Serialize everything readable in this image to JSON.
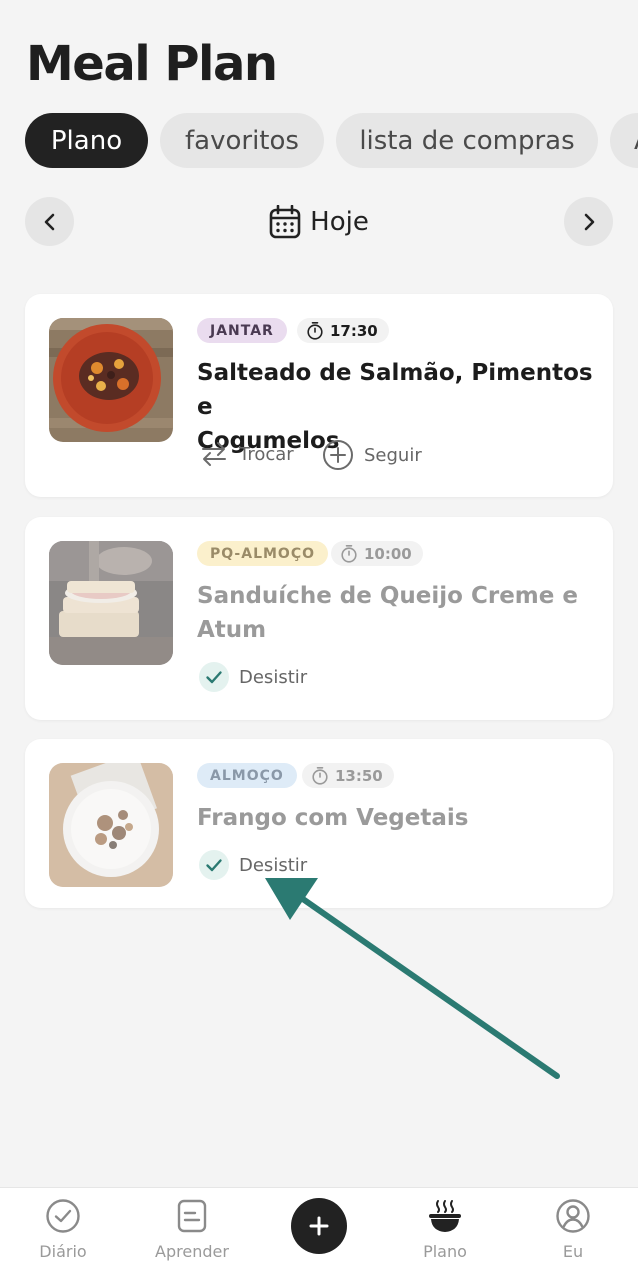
{
  "page": {
    "title": "Meal Plan"
  },
  "tabs": [
    {
      "label": "Plano",
      "active": true
    },
    {
      "label": "favoritos",
      "active": false
    },
    {
      "label": "lista de compras",
      "active": false
    },
    {
      "label": "A",
      "active": false
    }
  ],
  "date_nav": {
    "label": "Hoje",
    "prev_icon": "chevron-left-icon",
    "next_icon": "chevron-right-icon",
    "calendar_icon": "calendar-icon"
  },
  "meals": [
    {
      "badge": "JANTAR",
      "badge_bg": "#eadcef",
      "badge_color": "#4a3a52",
      "time": "17:30",
      "name_line1": "Salteado de Salmão, Pimentos e",
      "name_line2": "Cogumelos",
      "actions": [
        {
          "label": "Trocar",
          "icon": "swap-icon"
        },
        {
          "label": "Seguir",
          "icon": "plus-circle-icon"
        }
      ]
    },
    {
      "badge": "PQ-ALMOÇO",
      "badge_bg": "#fbf0cc",
      "badge_color": "#9a8b68",
      "time": "10:00",
      "name_line1": "Sanduíche de Queijo Creme e",
      "name_line2": "Atum",
      "actions": [
        {
          "label": "Desistir",
          "icon": "check-icon"
        }
      ]
    },
    {
      "badge": "ALMOÇO",
      "badge_bg": "#deebf7",
      "badge_color": "#8a98a8",
      "time": "13:50",
      "name_line1": "Frango com Vegetais",
      "actions": [
        {
          "label": "Desistir",
          "icon": "check-icon"
        }
      ]
    }
  ],
  "bottom_nav": [
    {
      "label": "Diário",
      "icon": "check-circle-icon",
      "active": false
    },
    {
      "label": "Aprender",
      "icon": "document-icon",
      "active": false
    },
    {
      "label": "",
      "icon": "plus-icon",
      "active": false
    },
    {
      "label": "Plano",
      "icon": "bowl-icon",
      "active": true
    },
    {
      "label": "Eu",
      "icon": "user-icon",
      "active": false
    }
  ],
  "colors": {
    "accent": "#2b7a72",
    "dark": "#222222",
    "background": "#f4f4f4"
  }
}
